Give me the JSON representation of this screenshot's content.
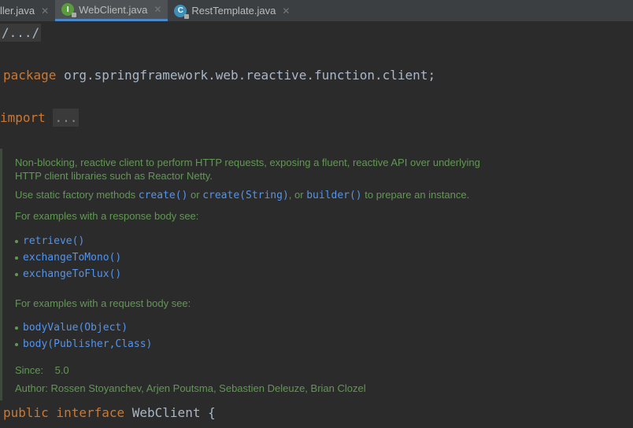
{
  "tabs": [
    {
      "label": "ller.java"
    },
    {
      "label": "WebClient.java",
      "icon": "I",
      "active": true
    },
    {
      "label": "RestTemplate.java",
      "icon": "C"
    }
  ],
  "code": {
    "fold_header": "/.../",
    "package_kw": "package",
    "package_name": " org.springframework.web.reactive.function.client;",
    "import_kw": "import",
    "import_fold": "...",
    "public_kw": "public",
    "interface_kw": " interface",
    "decl": " WebClient {"
  },
  "doc": {
    "line1": "Non-blocking, reactive client to perform HTTP requests, exposing a fluent, reactive API over underlying",
    "line2": "HTTP client libraries such as Reactor Netty.",
    "use_pre": "Use static factory methods ",
    "create": "create()",
    "or1": " or ",
    "create_string": "create(String)",
    "or2": ", or ",
    "builder": "builder()",
    "use_post": " to prepare an instance.",
    "response_intro": "For examples with a response body see:",
    "response_links": [
      "retrieve()",
      "exchangeToMono()",
      "exchangeToFlux()"
    ],
    "request_intro": "For examples with a request body see:",
    "request_links": [
      "bodyValue(Object)",
      "body(Publisher,Class)"
    ],
    "since_label": "Since:",
    "since_value": "5.0",
    "author": "Author: Rossen Stoyanchev, Arjen Poutsma, Sebastien Deleuze, Brian Clozel"
  }
}
